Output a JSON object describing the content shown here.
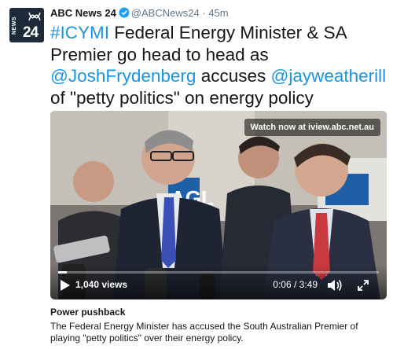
{
  "avatar": {
    "news_text": "NEWS",
    "number_text": "24"
  },
  "tweet": {
    "author_name": "ABC News 24",
    "handle": "@ABCNews24",
    "separator": "·",
    "time": "45m",
    "text": {
      "hashtag": "#ICYMI",
      "part1": " Federal Energy Minister & SA Premier go head to head as ",
      "mention1": "@JoshFrydenberg",
      "part2": " accuses ",
      "mention2": "@jayweatherill",
      "part3": " of  \"petty politics\" on energy policy"
    }
  },
  "media": {
    "watch_badge": "Watch now at iview.abc.net.au",
    "views": "1,040 views",
    "timecode": "0:06 / 3:49",
    "progress": 0.026,
    "scene_text": "AGL"
  },
  "card": {
    "title": "Power pushback",
    "description": "The Federal Energy Minister has accused the South Australian Premier of playing \"petty politics\" over their energy policy."
  },
  "colors": {
    "link": "#1b95e0",
    "verified": "#1da1f2",
    "text": "#14171a",
    "muted": "#657786"
  },
  "icons": [
    "abc-logo-icon",
    "verified-icon",
    "play-icon",
    "volume-icon",
    "fullscreen-icon"
  ]
}
